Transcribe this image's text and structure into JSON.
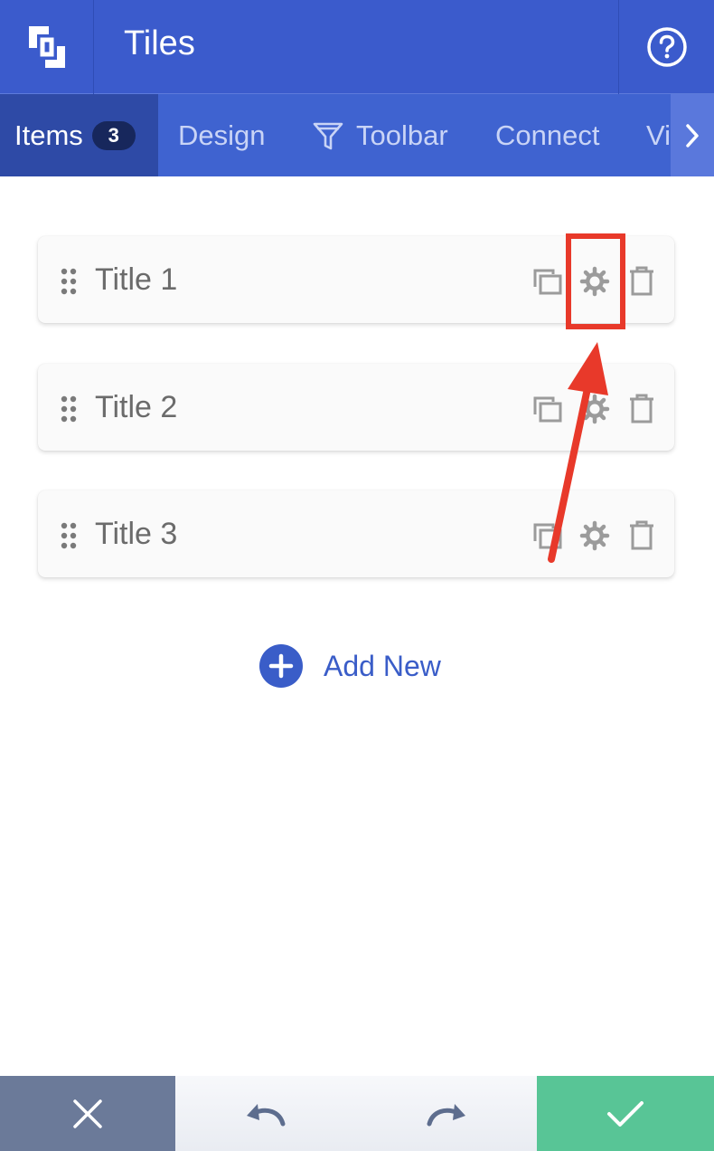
{
  "header": {
    "title": "Tiles",
    "logo_icon": "brand-logo-icon",
    "help_icon": "help-icon"
  },
  "tabs": [
    {
      "label": "Items",
      "badge": "3",
      "active": true
    },
    {
      "label": "Design",
      "active": false
    },
    {
      "label": "Toolbar",
      "icon": "filter-icon",
      "active": false
    },
    {
      "label": "Connect",
      "active": false
    },
    {
      "label": "Vi",
      "active": false
    }
  ],
  "items": [
    {
      "title": "Title 1"
    },
    {
      "title": "Title 2"
    },
    {
      "title": "Title 3"
    }
  ],
  "item_actions": [
    "duplicate-icon",
    "gear-icon",
    "trash-icon"
  ],
  "add_new": {
    "label": "Add New"
  },
  "footer": {
    "cancel_icon": "close-icon",
    "undo_icon": "undo-icon",
    "redo_icon": "redo-icon",
    "confirm_icon": "check-icon"
  },
  "colors": {
    "header": "#3b5bcc",
    "tab_bar": "#3f63d0",
    "tab_active": "#2e4aa6",
    "accent": "#3a5dc8",
    "annotation": "#e8392a",
    "cancel": "#6b7a99",
    "confirm": "#58c596"
  }
}
